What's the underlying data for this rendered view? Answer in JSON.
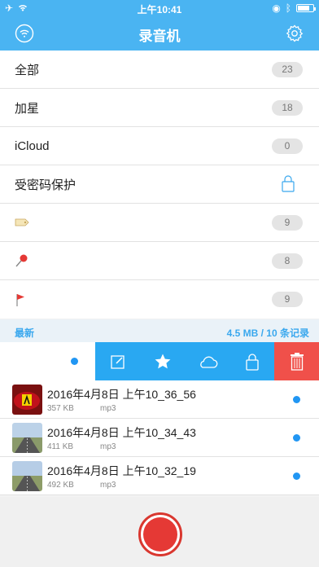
{
  "status_bar": {
    "time": "上午10:41"
  },
  "nav": {
    "title": "录音机"
  },
  "categories": [
    {
      "label": "全部",
      "count": "23"
    },
    {
      "label": "加星",
      "count": "18"
    },
    {
      "label": "iCloud",
      "count": "0"
    },
    {
      "label": "受密码保护",
      "icon": "lock-icon"
    },
    {
      "icon": "tag-icon",
      "count": "9"
    },
    {
      "icon": "pin-icon",
      "count": "8"
    },
    {
      "icon": "flag-icon",
      "count": "9"
    }
  ],
  "section": {
    "left": "最新",
    "right": "4.5 MB / 10 条记录"
  },
  "actions": [
    "edit-icon",
    "star-icon",
    "cloud-icon",
    "lock-icon",
    "trash-icon"
  ],
  "recordings": [
    {
      "title": "2016年4月8日 上午10_36_56",
      "size": "357 KB",
      "format": "mp3"
    },
    {
      "title": "2016年4月8日 上午10_34_43",
      "size": "411 KB",
      "format": "mp3"
    },
    {
      "title": "2016年4月8日 上午10_32_19",
      "size": "492 KB",
      "format": "mp3"
    }
  ],
  "colors": {
    "accent": "#4ab4f2",
    "delete": "#f0504a",
    "record": "#e53935"
  }
}
